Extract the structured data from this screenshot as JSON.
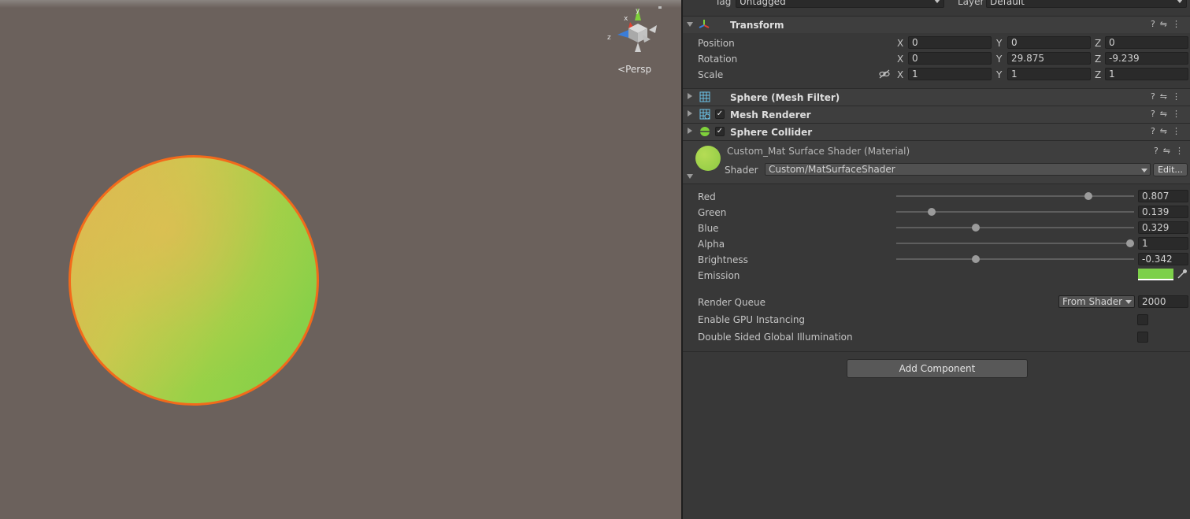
{
  "scene": {
    "projection_label": "Persp",
    "gizmo_axes": {
      "x": "x",
      "y": "y",
      "z": "z"
    }
  },
  "header": {
    "tag_label": "Tag",
    "tag_value": "Untagged",
    "layer_label": "Layer",
    "layer_value": "Default"
  },
  "transform": {
    "title": "Transform",
    "rows": [
      {
        "label": "Position",
        "x": "0",
        "y": "0",
        "z": "0"
      },
      {
        "label": "Rotation",
        "x": "0",
        "y": "29.875",
        "z": "-9.239"
      },
      {
        "label": "Scale",
        "x": "1",
        "y": "1",
        "z": "1"
      }
    ],
    "axis_labels": {
      "x": "X",
      "y": "Y",
      "z": "Z"
    }
  },
  "components": [
    {
      "title": "Sphere (Mesh Filter)",
      "has_checkbox": false
    },
    {
      "title": "Mesh Renderer",
      "has_checkbox": true,
      "checked": true
    },
    {
      "title": "Sphere Collider",
      "has_checkbox": true,
      "checked": true
    }
  ],
  "material": {
    "title": "Custom_Mat Surface Shader (Material)",
    "shader_label": "Shader",
    "shader_value": "Custom/MatSurfaceShader",
    "edit_label": "Edit...",
    "preview_color": "#9fd14a",
    "properties": [
      {
        "label": "Red",
        "value": "0.807",
        "fraction": 0.807
      },
      {
        "label": "Green",
        "value": "0.139",
        "fraction": 0.15
      },
      {
        "label": "Blue",
        "value": "0.329",
        "fraction": 0.335
      },
      {
        "label": "Alpha",
        "value": "1",
        "fraction": 0.985
      },
      {
        "label": "Brightness",
        "value": "-0.342",
        "fraction": 0.335
      }
    ],
    "emission_label": "Emission",
    "emission_color": "#7dd04a",
    "render_queue_label": "Render Queue",
    "render_queue_mode": "From Shader",
    "render_queue_value": "2000",
    "gpu_instancing_label": "Enable GPU Instancing",
    "gpu_instancing": false,
    "double_sided_gi_label": "Double Sided Global Illumination",
    "double_sided_gi": false
  },
  "add_component_label": "Add Component",
  "colors": {
    "scene_bg": "#6b615c",
    "sphere_outline": "#f26a1b",
    "inspector_bg": "#383838"
  }
}
